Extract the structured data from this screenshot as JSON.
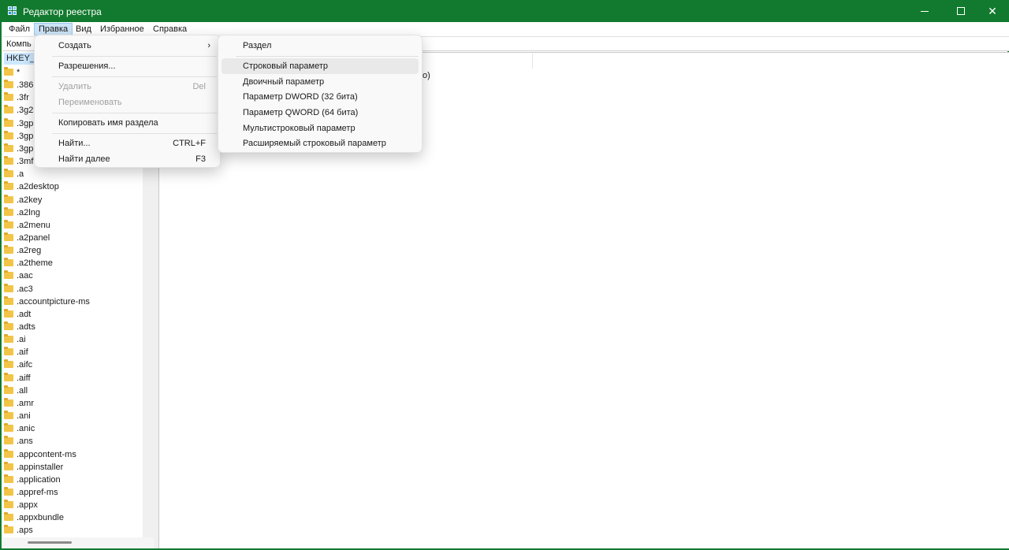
{
  "window": {
    "title": "Редактор реестра",
    "accent": "#127a2e"
  },
  "menubar": {
    "items": [
      "Файл",
      "Правка",
      "Вид",
      "Избранное",
      "Справка"
    ],
    "active": "Правка"
  },
  "address": {
    "text": "Компь"
  },
  "tree": {
    "root": "HKEY_C",
    "items": [
      "*",
      ".386",
      ".3fr",
      ".3g2",
      ".3gp",
      ".3gp",
      ".3gp",
      ".3mf",
      ".a",
      ".a2desktop",
      ".a2key",
      ".a2lng",
      ".a2menu",
      ".a2panel",
      ".a2reg",
      ".a2theme",
      ".aac",
      ".ac3",
      ".accountpicture-ms",
      ".adt",
      ".adts",
      ".ai",
      ".aif",
      ".aifc",
      ".aiff",
      ".all",
      ".amr",
      ".ani",
      ".anic",
      ".ans",
      ".appcontent-ms",
      ".appinstaller",
      ".application",
      ".appref-ms",
      ".appx",
      ".appxbundle",
      ".aps"
    ],
    "folder_color": "#f2c548"
  },
  "right_pane": {
    "partial_text": "о)"
  },
  "edit_menu": {
    "create": "Создать",
    "permissions": "Разрешения...",
    "delete": "Удалить",
    "delete_shortcut": "Del",
    "rename": "Переименовать",
    "copy_key_name": "Копировать имя раздела",
    "find": "Найти...",
    "find_shortcut": "CTRL+F",
    "find_next": "Найти далее",
    "find_next_shortcut": "F3"
  },
  "create_menu": {
    "key": "Раздел",
    "string_value": "Строковый параметр",
    "binary_value": "Двоичный параметр",
    "dword_value": "Параметр DWORD (32 бита)",
    "qword_value": "Параметр QWORD (64 бита)",
    "multi_string_value": "Мультистроковый параметр",
    "expandable_string_value": "Расширяемый строковый параметр",
    "highlighted": "Строковый параметр"
  }
}
